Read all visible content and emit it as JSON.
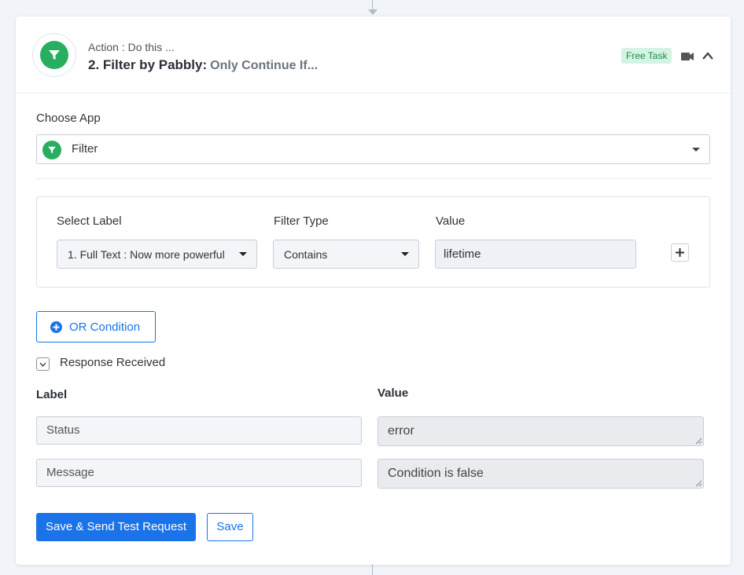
{
  "step": {
    "action_label": "Action : Do this ...",
    "title": "2. Filter by Pabbly:",
    "subtitle": "Only Continue If...",
    "badge": "Free Task",
    "icons": [
      "filter-icon",
      "video-icon",
      "chevron-up-icon"
    ],
    "colors": {
      "app_green": "#27ae60",
      "accent_blue": "#1a73e8",
      "badge_bg": "#d4f3e3",
      "badge_text": "#1e8e4e"
    }
  },
  "choose_app": {
    "label": "Choose App",
    "selected": "Filter"
  },
  "condition": {
    "select_label_header": "Select Label",
    "filter_type_header": "Filter Type",
    "value_header": "Value",
    "select_label_value": "1. Full Text : Now more powerful",
    "filter_type_value": "Contains",
    "value": "lifetime"
  },
  "or_condition": {
    "label": "OR Condition"
  },
  "response": {
    "toggle_label": "Response Received",
    "label_header": "Label",
    "value_header": "Value",
    "rows": [
      {
        "label": "Status",
        "value": "error"
      },
      {
        "label": "Message",
        "value": "Condition is false"
      }
    ]
  },
  "buttons": {
    "save_and_send": "Save & Send Test Request",
    "save": "Save"
  }
}
